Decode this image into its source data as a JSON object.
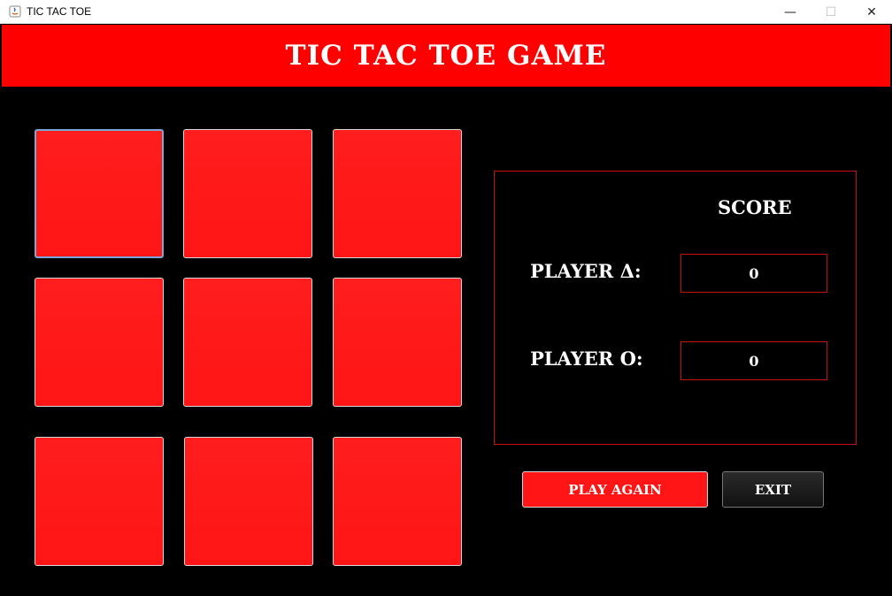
{
  "window": {
    "title": "TIC TAC TOE",
    "controls": {
      "minimize": "—",
      "maximize": "☐",
      "close": "✕"
    }
  },
  "header": {
    "title": "TIC TAC TOE GAME"
  },
  "board": {
    "cells": [
      "",
      "",
      "",
      "",
      "",
      "",
      "",
      "",
      ""
    ]
  },
  "score": {
    "title": "SCORE",
    "player_triangle_label": "PLAYER Δ:",
    "player_triangle_value": "0",
    "player_o_label": "PLAYER O:",
    "player_o_value": "0"
  },
  "buttons": {
    "play_again": "PLAY AGAIN",
    "exit": "EXIT"
  },
  "colors": {
    "header": "#ff0000",
    "cell": "#ff1515",
    "background": "#000000",
    "panel_border": "#c81010"
  }
}
